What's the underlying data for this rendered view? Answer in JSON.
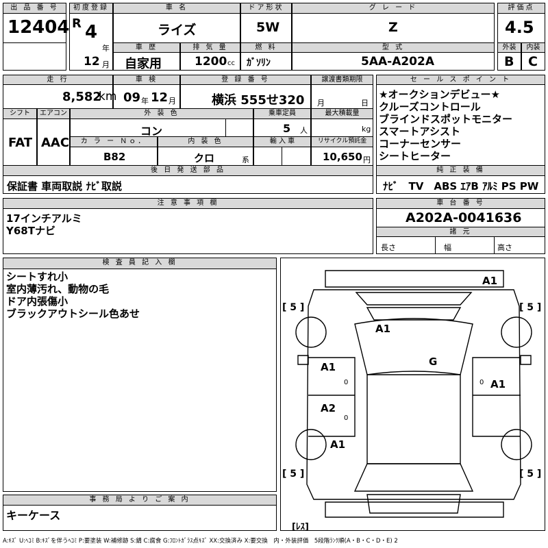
{
  "headers": {
    "lot_no": "出 品 番 号",
    "first_reg": "初度登録",
    "car_name": "車 名",
    "door": "ドア形状",
    "grade": "グ レ ー ド",
    "score": "評価点",
    "history": "車 歴",
    "displacement": "排 気 量",
    "fuel": "燃 料",
    "model": "型 式",
    "exterior": "外装",
    "interior": "内装",
    "mileage": "走 行",
    "inspection": "車 検",
    "reg_no": "登 録 番 号",
    "transfer_deadline": "譲渡書類期限",
    "sales_points": "セ ー ル ス ポ イ ン ト",
    "shift": "シフト",
    "ac": "エアコン",
    "ext_color": "外 装 色",
    "capacity": "乗車定員",
    "max_load": "最大積載量",
    "color_no": "カ ラ ー Ｎｏ．",
    "int_color": "内 装 色",
    "import": "輸 入 車",
    "recycle": "リサイクル預託金",
    "later_parts": "後 日 発 送 部 品",
    "equipment": "純 正 装 備",
    "notes": "注 意 事 項 欄",
    "chassis": "車 台 番 号",
    "specs": "諸 元",
    "inspector": "検 査 員 記 入 欄",
    "office": "事 務 局 よ り ご 案 内"
  },
  "values": {
    "lot_no": "12404",
    "era": "R",
    "year": "4",
    "year_unit": "年",
    "month": "12",
    "month_unit": "月",
    "car_name": "ライズ",
    "door": "5W",
    "grade": "Z",
    "score": "4.5",
    "history": "自家用",
    "displacement": "1200",
    "displacement_unit": "cc",
    "fuel": "ｶﾞｿﾘﾝ",
    "model": "5AA-A202A",
    "exterior": "B",
    "interior": "C",
    "mileage": "8,582",
    "mileage_unit": "km",
    "insp_year": "09",
    "insp_year_unit": "年",
    "insp_month": "12",
    "insp_month_unit": "月",
    "reg_no": "横浜 555せ320",
    "deadline_month": "月",
    "deadline_day": "日",
    "shift": "FAT",
    "ac": "AAC",
    "ext_color": "コン",
    "capacity": "5",
    "capacity_unit": "人",
    "max_load_unit": "kg",
    "color_no": "B82",
    "int_color": "クロ",
    "int_color_unit": "系",
    "recycle": "10,650",
    "recycle_unit": "円",
    "later_parts": "保証書 車両取説 ﾅﾋﾞ取説",
    "equipment": "ﾅﾋﾞ　TV　ABS ｴｱB ｱﾙﾐ PS PW",
    "chassis": "A202A-0041636",
    "length_label": "長さ",
    "width_label": "幅",
    "height_label": "高さ",
    "office": "キーケース"
  },
  "sales_points": [
    "★オークションデビュー★",
    "クルーズコントロール",
    "ブラインドスポットモニター",
    "スマートアシスト",
    "コーナーセンサー",
    "シートヒーター"
  ],
  "notes": [
    "17インチアルミ",
    "Y68Tナビ"
  ],
  "inspector_notes": [
    "シートすれ小",
    "室内薄汚れ、動物の毛",
    "ドア内張傷小",
    "ブラックアウトシール色あせ"
  ],
  "diagram": {
    "marks": [
      "A1",
      "A1",
      "G",
      "A1",
      "A1",
      "A2",
      "A1"
    ],
    "tires": [
      "[ 5 ]",
      "[ 5 ]",
      "[ 5 ]",
      "[ 5 ]"
    ],
    "spare": "[ﾚｽ]",
    "zero": "0"
  },
  "legend": "A:ｷｽﾞ U:ﾍｺﾐ B:ｷｽﾞを伴うﾍｺﾐ P:要塗装 W:補修跡 S:錆 C:腐食 G:ﾌﾛﾝﾄｶﾞﾗｽ点ｷｽﾞ XX:交換済み X:要交換　内・外装評価　5段階ﾗﾝｸ順(A・B・C・D・E) 2"
}
